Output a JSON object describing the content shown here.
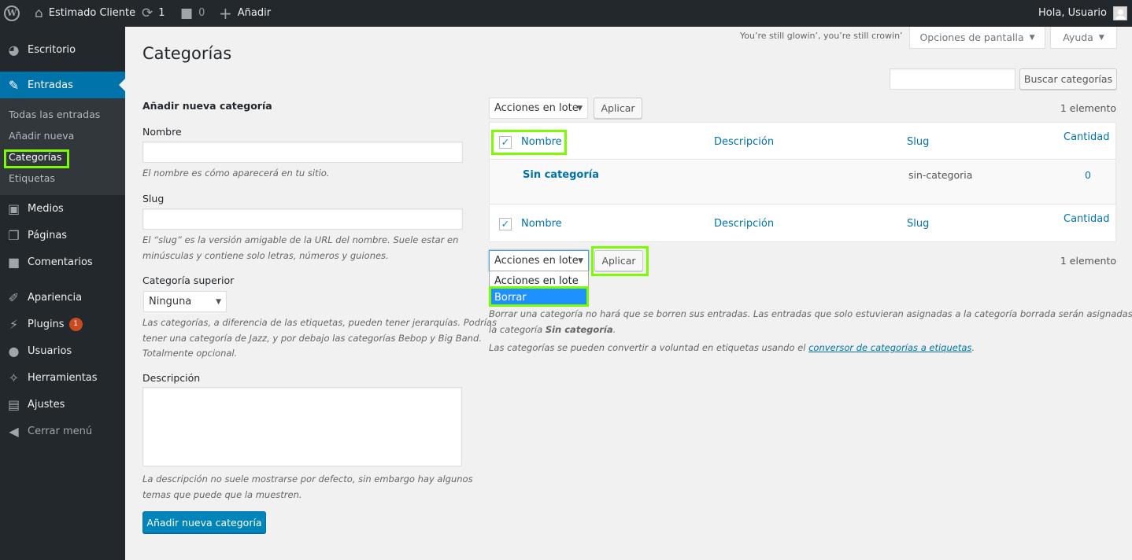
{
  "adminbar": {
    "site_name": "Estimado Cliente",
    "updates_count": "1",
    "comments_count": "0",
    "new_label": "Añadir",
    "greeting": "Hola, Usuario"
  },
  "sidebar": {
    "items": [
      {
        "label": "Escritorio",
        "icon": "dashboard-icon"
      },
      {
        "label": "Entradas",
        "icon": "pushpin-icon"
      },
      {
        "label": "Medios",
        "icon": "media-icon"
      },
      {
        "label": "Páginas",
        "icon": "pages-icon"
      },
      {
        "label": "Comentarios",
        "icon": "comments-icon"
      },
      {
        "label": "Apariencia",
        "icon": "appearance-icon"
      },
      {
        "label": "Plugins",
        "icon": "plugins-icon",
        "badge": "1"
      },
      {
        "label": "Usuarios",
        "icon": "users-icon"
      },
      {
        "label": "Herramientas",
        "icon": "tools-icon"
      },
      {
        "label": "Ajustes",
        "icon": "settings-icon"
      },
      {
        "label": "Cerrar menú",
        "icon": "collapse-icon"
      }
    ],
    "submenu": [
      "Todas las entradas",
      "Añadir nueva",
      "Categorías",
      "Etiquetas"
    ]
  },
  "header": {
    "lyric": "You’re still glowin’, you’re still crowin’",
    "screen_options": "Opciones de pantalla",
    "help": "Ayuda",
    "page_title": "Categorías"
  },
  "search": {
    "value": "",
    "button": "Buscar categorías"
  },
  "form": {
    "heading": "Añadir nueva categoría",
    "name_label": "Nombre",
    "name_value": "",
    "name_help": "El nombre es cómo aparecerá en tu sitio.",
    "slug_label": "Slug",
    "slug_value": "",
    "slug_help_1": "El “slug” es la versión amigable de la URL del nombre. Suele estar en",
    "slug_help_2": "minúsculas y contiene solo letras, números y guiones.",
    "parent_label": "Categoría superior",
    "parent_value": "Ninguna",
    "parent_help_1": "Las categorías, a diferencia de las etiquetas, pueden tener jerarquías. Podrías",
    "parent_help_2": "tener una categoría de Jazz, y por debajo las categorías Bebop y Big Band.",
    "parent_help_3": "Totalmente opcional.",
    "desc_label": "Descripción",
    "desc_value": "",
    "desc_help_1": "La descripción no suele mostrarse por defecto, sin embargo hay algunos",
    "desc_help_2": "temas que puede que la muestren.",
    "submit": "Añadir nueva categoría"
  },
  "list": {
    "bulk_label": "Acciones en lote",
    "apply": "Aplicar",
    "count": "1 elemento",
    "columns": {
      "name": "Nombre",
      "description": "Descripción",
      "slug": "Slug",
      "count": "Cantidad"
    },
    "rows": [
      {
        "name": "Sin categoría",
        "description": "",
        "slug": "sin-categoria",
        "count": "0"
      }
    ],
    "dropdown_options": [
      "Acciones en lote",
      "Borrar"
    ],
    "note_1": "Borrar una categoría no hará que se borren sus entradas. Las entradas que solo estuvieran asignadas a la categoría borrada serán asignadas a",
    "note_2_prefix": "la categoría",
    "note_2_bold": "Sin categoría",
    "note_2_suffix": ".",
    "note_3_prefix": "Las categorías se pueden convertir a voluntad en etiquetas usando el",
    "note_3_link": "conversor de categorías a etiquetas",
    "note_3_suffix": "."
  },
  "colors": {
    "accent": "#0073aa",
    "highlight": "#7cfc00",
    "primary": "#0085ba",
    "sidebar": "#23282d"
  }
}
